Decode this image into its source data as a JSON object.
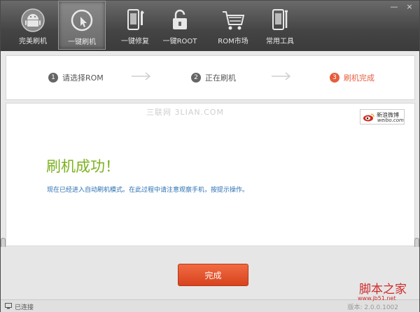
{
  "toolbar": {
    "items": [
      {
        "label": "完美刷机",
        "icon": "android-icon"
      },
      {
        "label": "一键刷机",
        "icon": "one-click-flash-icon"
      },
      {
        "label": "一键修复",
        "icon": "repair-icon"
      },
      {
        "label": "一键ROOT",
        "icon": "root-lock-icon"
      },
      {
        "label": "ROM市场",
        "icon": "cart-icon"
      },
      {
        "label": "常用工具",
        "icon": "tools-icon"
      }
    ],
    "minimize": "—",
    "close": "×"
  },
  "steps": [
    {
      "num": "1",
      "label": "请选择ROM"
    },
    {
      "num": "2",
      "label": "正在刷机"
    },
    {
      "num": "3",
      "label": "刷机完成"
    }
  ],
  "content": {
    "watermark": "三联网 3LIAN.COM",
    "weibo_cn": "新浪微博",
    "weibo_en": "weibo.com",
    "title": "刷机成功！",
    "message": "现在已经进入自动刷机模式。在此过程中请注意观察手机，按提示操作。"
  },
  "button": {
    "done": "完成"
  },
  "status": {
    "device": "已连接",
    "version": "版本: 2.0.0.1002"
  },
  "brand": {
    "name": "脚本之家",
    "url": "www.jb51.net"
  },
  "colors": {
    "accent": "#e65d3c",
    "success": "#7bb21f",
    "link": "#2a6fb1"
  }
}
